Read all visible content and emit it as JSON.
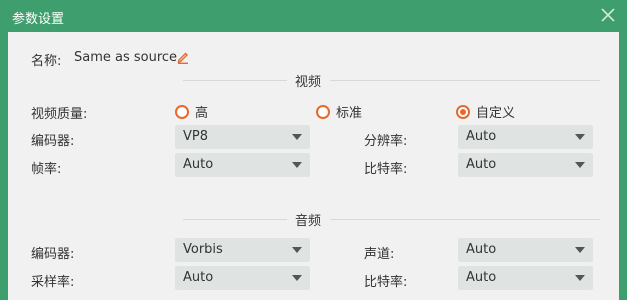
{
  "window": {
    "title": "参数设置"
  },
  "name": {
    "label": "名称:",
    "value": "Same as source"
  },
  "video": {
    "section_title": "视频",
    "quality": {
      "label": "视频质量:",
      "options": [
        {
          "label": "高",
          "checked": false
        },
        {
          "label": "标准",
          "checked": false
        },
        {
          "label": "自定义",
          "checked": true
        }
      ]
    },
    "encoder": {
      "label": "编码器:",
      "value": "VP8"
    },
    "resolution": {
      "label": "分辨率:",
      "value": "Auto"
    },
    "frame_rate": {
      "label": "帧率:",
      "value": "Auto"
    },
    "bitrate": {
      "label": "比特率:",
      "value": "Auto"
    }
  },
  "audio": {
    "section_title": "音频",
    "encoder": {
      "label": "编码器:",
      "value": "Vorbis"
    },
    "channel": {
      "label": "声道:",
      "value": "Auto"
    },
    "sample_rate": {
      "label": "采样率:",
      "value": "Auto"
    },
    "bitrate": {
      "label": "比特率:",
      "value": "Auto"
    }
  },
  "colors": {
    "header": "#3e9e6e",
    "accent": "#e6692d",
    "panel": "#f1f1f1"
  },
  "icons": {
    "close": "close-icon",
    "edit": "pencil-icon"
  }
}
